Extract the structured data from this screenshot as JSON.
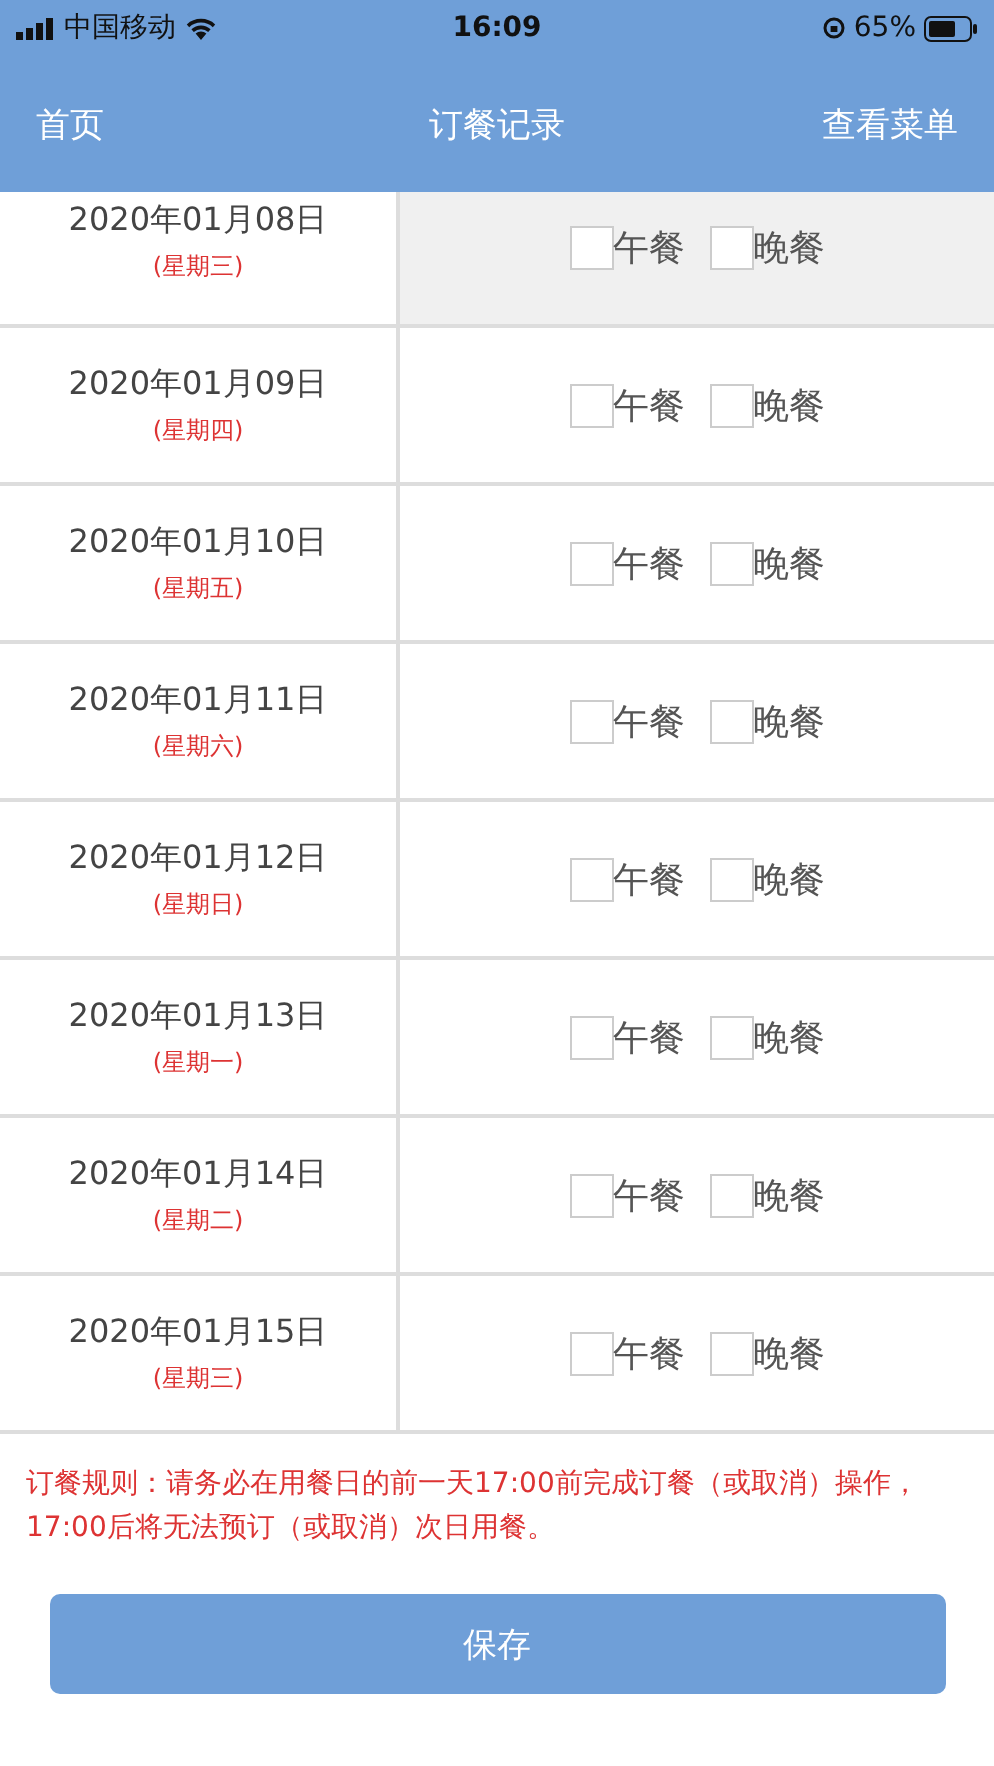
{
  "status_bar": {
    "carrier": "中国移动",
    "time": "16:09",
    "battery": "65%"
  },
  "nav": {
    "left": "首页",
    "title": "订餐记录",
    "right": "查看菜单"
  },
  "rows": [
    {
      "date": "2020年01月08日",
      "weekday": "(星期三)",
      "disabled": true,
      "options": [
        {
          "label": "午餐",
          "checked": false
        },
        {
          "label": "晚餐",
          "checked": false
        }
      ]
    },
    {
      "date": "2020年01月09日",
      "weekday": "(星期四)",
      "disabled": false,
      "options": [
        {
          "label": "午餐",
          "checked": false
        },
        {
          "label": "晚餐",
          "checked": false
        }
      ]
    },
    {
      "date": "2020年01月10日",
      "weekday": "(星期五)",
      "disabled": false,
      "options": [
        {
          "label": "午餐",
          "checked": false
        },
        {
          "label": "晚餐",
          "checked": false
        }
      ]
    },
    {
      "date": "2020年01月11日",
      "weekday": "(星期六)",
      "disabled": false,
      "options": [
        {
          "label": "午餐",
          "checked": false
        },
        {
          "label": "晚餐",
          "checked": false
        }
      ]
    },
    {
      "date": "2020年01月12日",
      "weekday": "(星期日)",
      "disabled": false,
      "options": [
        {
          "label": "午餐",
          "checked": false
        },
        {
          "label": "晚餐",
          "checked": false
        }
      ]
    },
    {
      "date": "2020年01月13日",
      "weekday": "(星期一)",
      "disabled": false,
      "options": [
        {
          "label": "午餐",
          "checked": false
        },
        {
          "label": "晚餐",
          "checked": false
        }
      ]
    },
    {
      "date": "2020年01月14日",
      "weekday": "(星期二)",
      "disabled": false,
      "options": [
        {
          "label": "午餐",
          "checked": false
        },
        {
          "label": "晚餐",
          "checked": false
        }
      ]
    },
    {
      "date": "2020年01月15日",
      "weekday": "(星期三)",
      "disabled": false,
      "options": [
        {
          "label": "午餐",
          "checked": false
        },
        {
          "label": "晚餐",
          "checked": false
        }
      ]
    }
  ],
  "rule": "订餐规则：请务必在用餐日的前一天17:00前完成订餐（或取消）操作，17:00后将无法预订（或取消）次日用餐。",
  "save_button": "保存"
}
